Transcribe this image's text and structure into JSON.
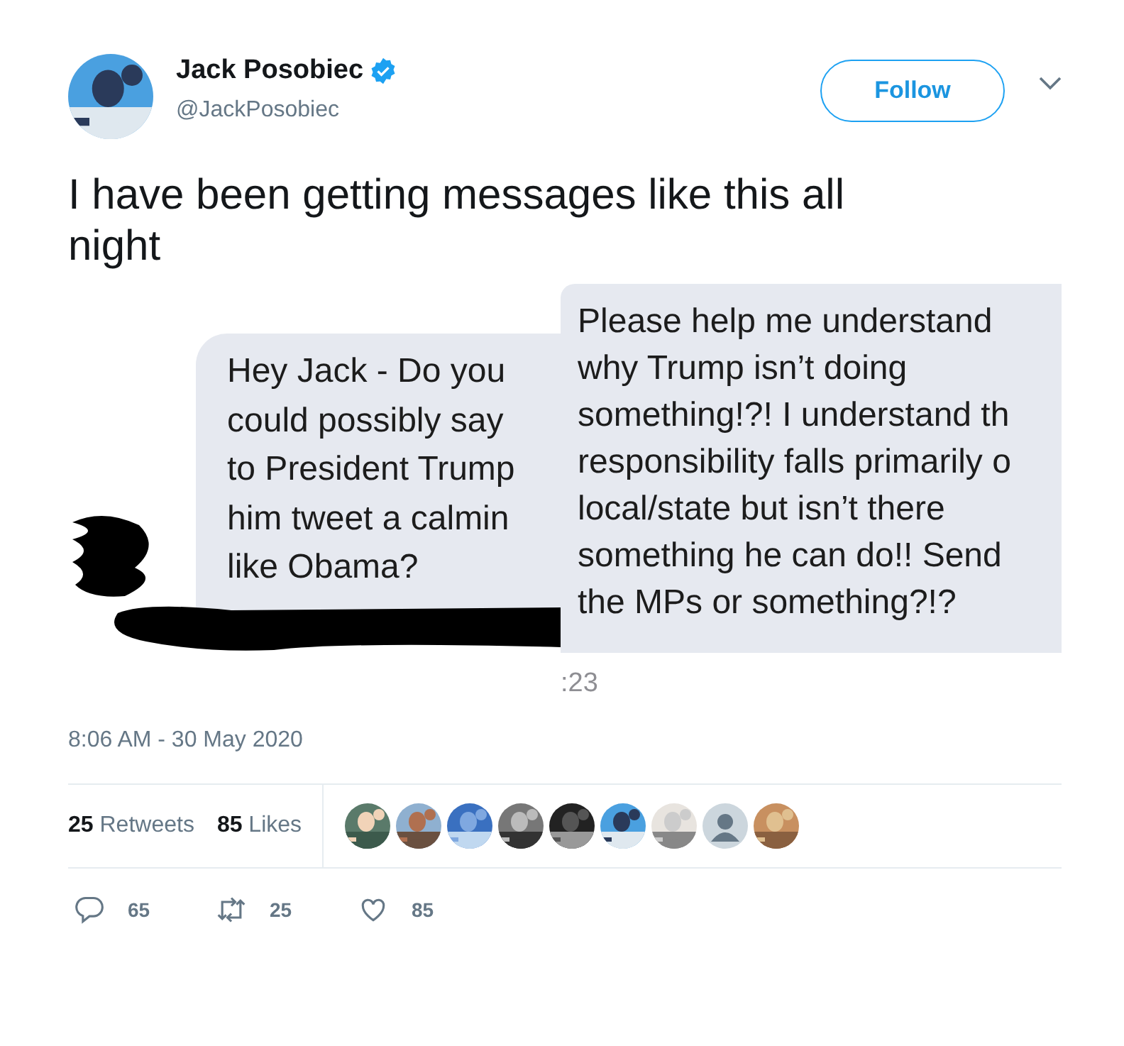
{
  "author": {
    "name": "Jack Posobiec",
    "handle": "@JackPosobiec",
    "verified": true,
    "avatar": {
      "kind": "picture"
    }
  },
  "follow_button": "Follow",
  "tweet_text": "I have been getting messages like this all night",
  "attached_image": {
    "left_message": [
      "Hey Jack - Do you",
      "could possibly say",
      "to President Trump",
      "him tweet a calmin",
      "like Obama?"
    ],
    "right_message": [
      "Please help me understand",
      "why Trump isn’t doing",
      "something!?! I understand th",
      "responsibility falls primarily o",
      "local/state but isn’t there",
      "something he can do!! Send",
      "the MPs or something?!?"
    ],
    "message_time": ":23"
  },
  "timestamp": "8:06 AM - 30 May 2020",
  "stats": [
    {
      "count": "25",
      "label": "Retweets"
    },
    {
      "count": "85",
      "label": "Likes"
    }
  ],
  "likers": [
    {
      "kind": "picture"
    },
    {
      "kind": "picture"
    },
    {
      "kind": "picture"
    },
    {
      "kind": "picture"
    },
    {
      "kind": "picture"
    },
    {
      "kind": "picture"
    },
    {
      "kind": "picture"
    },
    {
      "kind": "default"
    },
    {
      "kind": "picture"
    }
  ],
  "actions": [
    {
      "kind": "reply",
      "count": "65"
    },
    {
      "kind": "retweet",
      "count": "25"
    },
    {
      "kind": "like",
      "count": "85"
    }
  ]
}
